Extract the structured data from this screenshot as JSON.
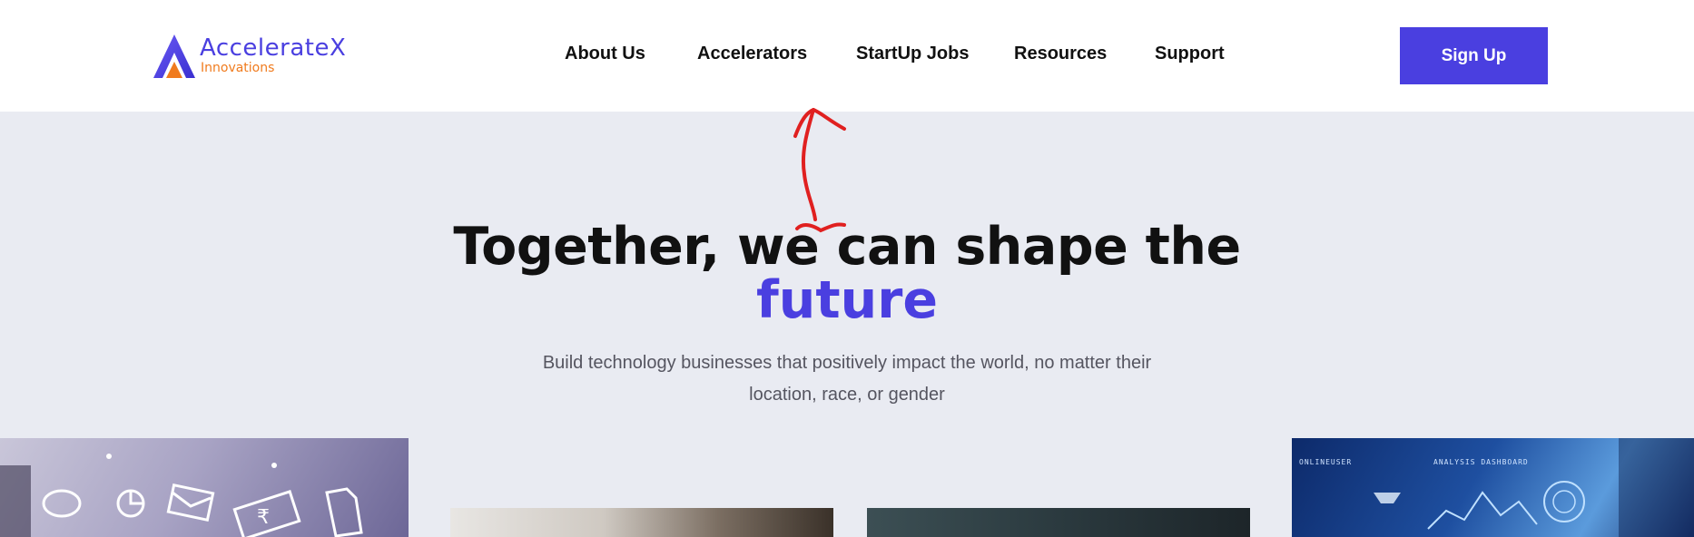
{
  "brand": {
    "name": "AccelerateX",
    "sub": "Innovations",
    "color_primary": "#4a3fe0",
    "color_secondary": "#f07b1e"
  },
  "nav": {
    "items": [
      {
        "label": "About Us"
      },
      {
        "label": "Accelerators"
      },
      {
        "label": "StartUp Jobs"
      },
      {
        "label": "Resources"
      },
      {
        "label": "Support"
      }
    ],
    "signup_label": "Sign Up"
  },
  "hero": {
    "title": "Together, we can shape the",
    "title_accent": "future",
    "subtitle": "Build technology businesses that positively impact the world, no matter their location, race, or gender"
  },
  "images": {
    "dashboard_labels": [
      "ONLINEUSER",
      "ANALYSIS DASHBOARD"
    ]
  },
  "icons": [
    "logo-a-icon",
    "chat-icon",
    "pie-chart-icon",
    "mail-icon",
    "rupee-icon",
    "document-icon"
  ],
  "annotation": {
    "color": "#e02020",
    "shape": "hand-drawn-arrow"
  }
}
